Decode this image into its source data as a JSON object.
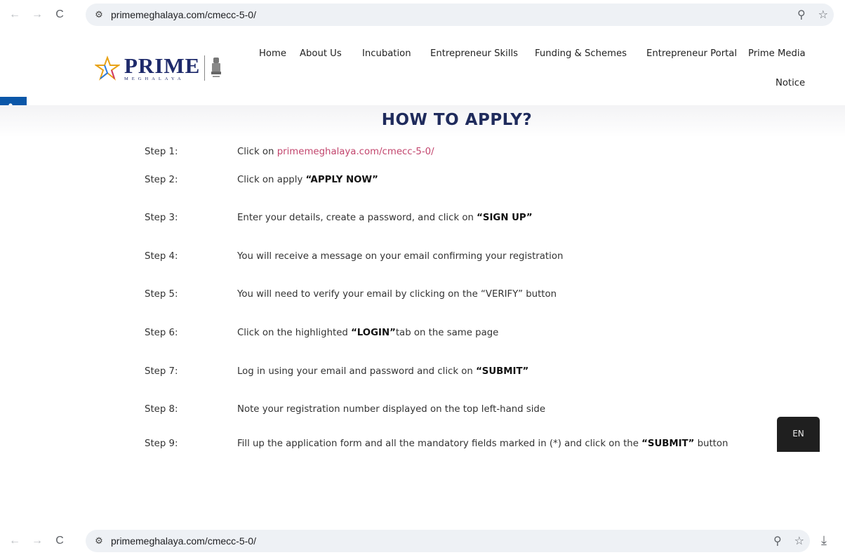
{
  "browser": {
    "url": "primemeghalaya.com/cmecc-5-0/",
    "back_icon": "arrow-left-icon",
    "forward_icon": "arrow-right-icon",
    "reload_icon": "reload-icon",
    "site_info_icon": "site-settings-icon",
    "zoom_icon": "zoom-icon",
    "bookmark_icon": "star-icon",
    "download_icon": "download-icon"
  },
  "logo": {
    "main": "PRIME",
    "sub": "MEGHALAYA"
  },
  "nav": {
    "home": "Home",
    "about": "About Us",
    "incubation": "Incubation",
    "skills": "Entrepreneur Skills",
    "funding": "Funding & Schemes",
    "portal": "Entrepreneur Portal",
    "media": "Prime Media",
    "notice": "Notice"
  },
  "title": "HOW TO APPLY?",
  "steps": [
    {
      "label": "Step 1:",
      "pre": "Click on ",
      "link": "primemeghalaya.com/cmecc-5-0/",
      "bold": "",
      "post": ""
    },
    {
      "label": "Step 2:",
      "pre": "Click on apply ",
      "link": "",
      "bold": "“APPLY NOW”",
      "post": ""
    },
    {
      "label": "Step 3:",
      "pre": "Enter your details, create a password, and click on ",
      "link": "",
      "bold": "“SIGN UP”",
      "post": ""
    },
    {
      "label": "Step 4:",
      "pre": "You will receive a message on your email confirming your registration",
      "link": "",
      "bold": "",
      "post": ""
    },
    {
      "label": "Step 5:",
      "pre": "You will need to verify your email by clicking on the “VERIFY” button",
      "link": "",
      "bold": "",
      "post": ""
    },
    {
      "label": "Step 6:",
      "pre": "Click on the highlighted ",
      "link": "",
      "bold": "“LOGIN”",
      "post": "tab on the same page"
    },
    {
      "label": "Step 7:",
      "pre": "Log in using your email and password and click on ",
      "link": "",
      "bold": "“SUBMIT”",
      "post": ""
    },
    {
      "label": "Step 8:",
      "pre": "Note your registration number displayed on the top left-hand side",
      "link": "",
      "bold": "",
      "post": ""
    },
    {
      "label": "Step 9:",
      "pre": "Fill up the application form and all the mandatory fields marked in (*) and click on the ",
      "link": "",
      "bold": "“SUBMIT”",
      "post": " button"
    }
  ],
  "language": "EN",
  "colors": {
    "title": "#1f2b5c",
    "link": "#c2456d",
    "accessibility": "#0b57a8",
    "lang_bg": "#1f1f1f"
  }
}
